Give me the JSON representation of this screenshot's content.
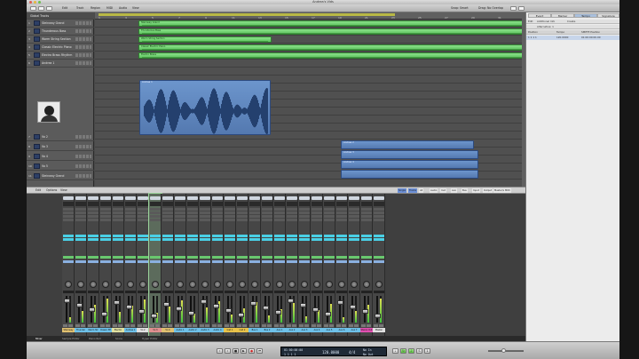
{
  "window": {
    "title": "Andrea's Vids"
  },
  "toolbar": {
    "items": [
      "Edit",
      "Track",
      "Region",
      "MIDI",
      "Audio",
      "View"
    ],
    "snap_label": "Snap:",
    "snap_value": "Smart",
    "drag_label": "Drag:",
    "drag_value": "No Overlap"
  },
  "ruler": {
    "bars": [
      "1",
      "3",
      "5",
      "7",
      "9",
      "11",
      "13",
      "15",
      "17",
      "19",
      "21",
      "23",
      "25",
      "27",
      "29",
      "31"
    ]
  },
  "tracks": {
    "folder_label": "Global Tracks",
    "rows": [
      {
        "num": "1",
        "name": "Steinway Grand"
      },
      {
        "num": "2",
        "name": "Thunderous Bass"
      },
      {
        "num": "3",
        "name": "Warm String Section"
      },
      {
        "num": "4",
        "name": "Classic Electric Piano"
      },
      {
        "num": "5",
        "name": "Electro Brass Rhythm"
      },
      {
        "num": "6",
        "name": "Andrea 1"
      },
      {
        "num": "7",
        "name": "Vo 2"
      },
      {
        "num": "8",
        "name": "Vo 3"
      },
      {
        "num": "9",
        "name": "Vo 4"
      },
      {
        "num": "10",
        "name": "Vo 5"
      },
      {
        "num": "11",
        "name": "Steinway Grand"
      }
    ]
  },
  "regions": {
    "green": [
      "Steinway Grand",
      "Thunderous Bass",
      "Warm String Section",
      "Classic Electric Piano",
      "Electro Brass"
    ],
    "blue": [
      "Andrea 1",
      "Andrea 2",
      "Andrea 3",
      "Andrea 4"
    ]
  },
  "lists": {
    "tabs": [
      "Event",
      "Marker",
      "Tempo",
      "Signature"
    ],
    "active_tab": "Tempo",
    "add_label": "Additional Info",
    "create_label": "Create",
    "alt_label": "Alternative: 1",
    "columns": [
      "Position",
      "Tempo",
      "SMPTE Position"
    ],
    "row": {
      "position": "1 1 1 1",
      "tempo": "120.0000",
      "smpte": "01:00:00:00.00"
    }
  },
  "mixer": {
    "toolbar": [
      "Edit",
      "Options",
      "View"
    ],
    "filters": [
      "Single",
      "Tracks",
      "All",
      "Audio",
      "Inst",
      "Aux",
      "Bus",
      "Input",
      "Output",
      "Master/VCA",
      "MIDI"
    ],
    "strips": [
      {
        "name": "Steinway",
        "color": "#e0c070"
      },
      {
        "name": "Thunder",
        "color": "#6ec0e8"
      },
      {
        "name": "Warm Str",
        "color": "#6ec0e8"
      },
      {
        "name": "Classic EP",
        "color": "#6ec0e8"
      },
      {
        "name": "Electro",
        "color": "#e0e0a0"
      },
      {
        "name": "Andrea 1",
        "color": "#6ec0e8"
      },
      {
        "name": "Vo 2",
        "color": "#e0e0e0"
      },
      {
        "name": "Vo 3",
        "color": "#e09090"
      },
      {
        "name": "Vo 4",
        "color": "#e0c070"
      },
      {
        "name": "Audio 1",
        "color": "#6ec0e8"
      },
      {
        "name": "Audio 2",
        "color": "#6ec0e8"
      },
      {
        "name": "Audio 3",
        "color": "#6ec0e8"
      },
      {
        "name": "Audio 4",
        "color": "#6ec0e8"
      },
      {
        "name": "Inst 1",
        "color": "#e8c24a"
      },
      {
        "name": "Inst 2",
        "color": "#e8c24a"
      },
      {
        "name": "Bus 1",
        "color": "#6ec0e8"
      },
      {
        "name": "Bus 2",
        "color": "#6ec0e8"
      },
      {
        "name": "Aux 1",
        "color": "#6ec0e8"
      },
      {
        "name": "Aux 2",
        "color": "#6ec0e8"
      },
      {
        "name": "Aux 3",
        "color": "#6ec0e8"
      },
      {
        "name": "Aux 4",
        "color": "#6ec0e8"
      },
      {
        "name": "Aux 5",
        "color": "#6ec0e8"
      },
      {
        "name": "Aux 6",
        "color": "#6ec0e8"
      },
      {
        "name": "Aux 7",
        "color": "#6ec0e8"
      },
      {
        "name": "Stereo Out",
        "color": "#e050b0"
      },
      {
        "name": "Master",
        "color": "#e0e0e0"
      }
    ]
  },
  "bottom_tabs": [
    "Mixer",
    "Sample Editor",
    "Piano Roll",
    "Score",
    "Hyper Editor"
  ],
  "transport": {
    "smpte": "01:00:00:00",
    "bars": "1 1 1 1",
    "tempo": "120.0000",
    "signature": "4/4",
    "key": "No In",
    "out": "No Out"
  }
}
